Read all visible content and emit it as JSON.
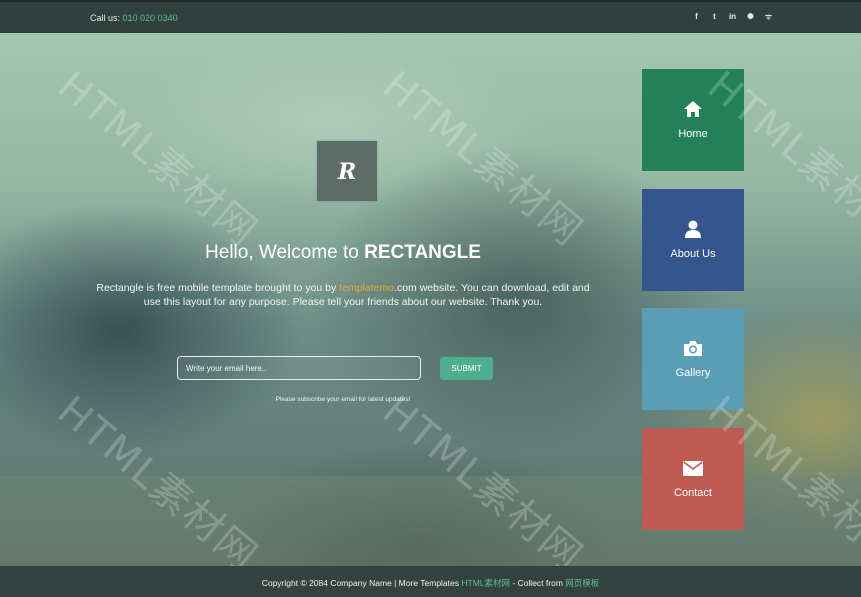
{
  "topbar": {
    "call_label": "Call us:",
    "phone": "010 020 0340",
    "social": [
      {
        "name": "facebook-icon",
        "glyph": "f"
      },
      {
        "name": "twitter-icon",
        "glyph": "t"
      },
      {
        "name": "linkedin-icon",
        "glyph": "in"
      },
      {
        "name": "dribbble-icon",
        "glyph": "✺"
      },
      {
        "name": "rss-icon",
        "glyph": "ᯤ"
      }
    ]
  },
  "hero": {
    "logo_letter": "R",
    "title_prefix": "Hello, Welcome to ",
    "title_brand": "RECTANGLE",
    "intro_before": "Rectangle is free mobile template brought to you by ",
    "intro_link": "templatemo",
    "intro_after": ".com website. You can download, edit and use this layout for any purpose. Please tell your friends about our website. Thank you."
  },
  "subscribe": {
    "placeholder": "Write your email here..",
    "button": "SUBMIT",
    "note": "Please subscribe your email for latest updates!"
  },
  "tiles": [
    {
      "label": "Home",
      "icon": "home-icon",
      "color": "#22805a"
    },
    {
      "label": "About Us",
      "icon": "user-icon",
      "color": "#36558c"
    },
    {
      "label": "Gallery",
      "icon": "camera-icon",
      "color": "#5b9eb4"
    },
    {
      "label": "Contact",
      "icon": "envelope-icon",
      "color": "#bd5a52"
    }
  ],
  "footer": {
    "text_before": "Copyright © 2084 Company Name | More Templates ",
    "link1": "HTML素材网",
    "text_mid": " - Collect from ",
    "link2": "网页模板"
  },
  "watermark": "HTML素材网",
  "colors": {
    "accent": "#4fae8f",
    "link": "#e0a939",
    "topbar": "#30403d"
  }
}
